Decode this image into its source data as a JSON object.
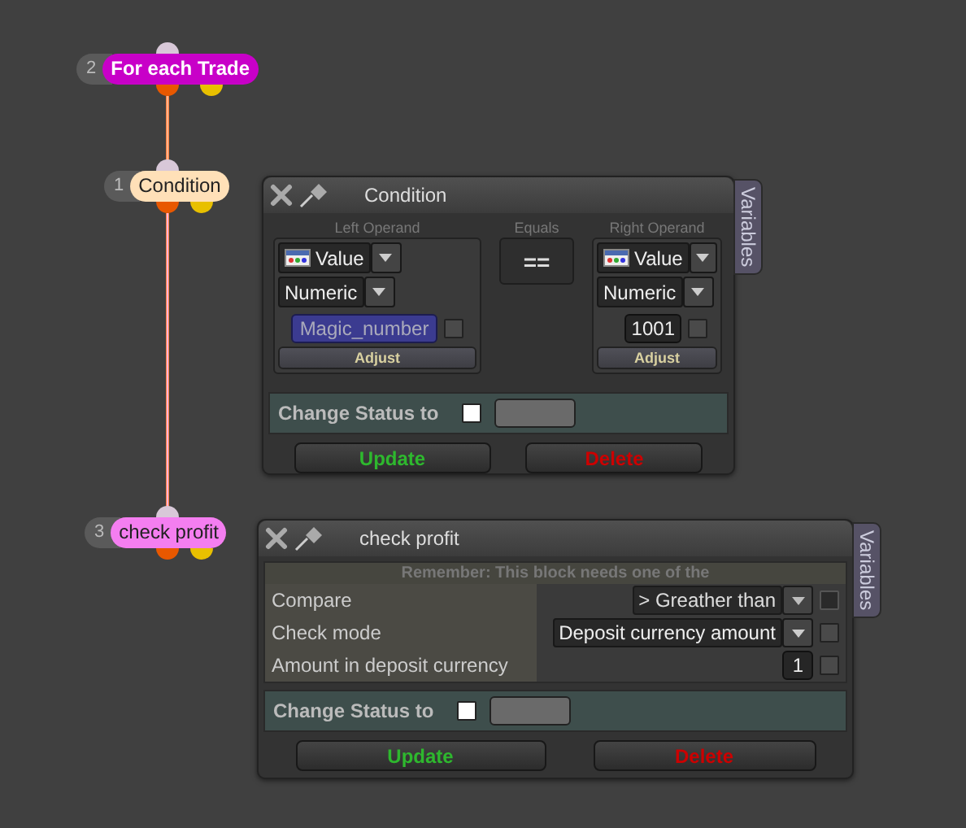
{
  "nodes": [
    {
      "number": "2",
      "label": "For each Trade",
      "color": "#c800c8"
    },
    {
      "number": "1",
      "label": "Condition",
      "color": "#ffe0b8"
    },
    {
      "number": "3",
      "label": "check profit",
      "color": "#f47ef0"
    }
  ],
  "condition_panel": {
    "title": "Condition",
    "side_tab": "Variables",
    "left_operand": {
      "heading": "Left Operand",
      "type": "Value",
      "format": "Numeric",
      "value": {
        "kind": "variable",
        "text": "Magic_number"
      },
      "checked": false,
      "adjust": "Adjust"
    },
    "operator": {
      "heading": "Equals",
      "symbol": "=="
    },
    "right_operand": {
      "heading": "Right Operand",
      "type": "Value",
      "format": "Numeric",
      "value": {
        "kind": "literal",
        "text": "1001"
      },
      "checked": false,
      "adjust": "Adjust"
    },
    "status": {
      "label": "Change Status to",
      "checked": false
    },
    "buttons": [
      "Update",
      "Delete"
    ]
  },
  "profit_panel": {
    "title": "check profit",
    "side_tab": "Variables",
    "notice": "Remember: This block needs one of the",
    "rows": [
      {
        "label": "Compare",
        "kind": "dropdown",
        "value": "> Greather than",
        "checked": false,
        "disabled": true
      },
      {
        "label": "Check mode",
        "kind": "dropdown",
        "value": "Deposit currency amount",
        "checked": false,
        "disabled": false
      },
      {
        "label": "Amount in deposit currency",
        "kind": "number",
        "value": "1",
        "checked": false,
        "disabled": false
      }
    ],
    "status": {
      "label": "Change Status to",
      "checked": false
    },
    "buttons": [
      "Update",
      "Delete"
    ]
  }
}
